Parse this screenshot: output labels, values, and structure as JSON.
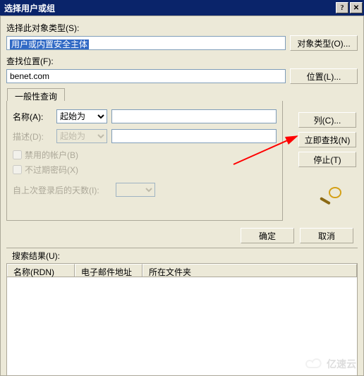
{
  "titlebar": {
    "title": "选择用户或组"
  },
  "object_type": {
    "label": "选择此对象类型(S):",
    "value": "用户或内置安全主体",
    "button": "对象类型(O)..."
  },
  "location": {
    "label": "查找位置(F):",
    "value": "benet.com",
    "button": "位置(L)..."
  },
  "tabs": {
    "general": "一般性查询"
  },
  "query": {
    "name_label": "名称(A):",
    "name_combo": "起始为",
    "desc_label": "描述(D):",
    "desc_combo": "起始为",
    "chk_disabled": "禁用的帐户(B)",
    "chk_noexpire": "不过期密码(X)",
    "days_label": "自上次登录后的天数(I):"
  },
  "buttons": {
    "columns": "列(C)...",
    "find_now": "立即查找(N)",
    "stop": "停止(T)",
    "ok": "确定",
    "cancel": "取消"
  },
  "results": {
    "label": "搜索结果(U):",
    "col_name": "名称(RDN)",
    "col_email": "电子邮件地址",
    "col_folder": "所在文件夹"
  },
  "watermark": "亿速云"
}
